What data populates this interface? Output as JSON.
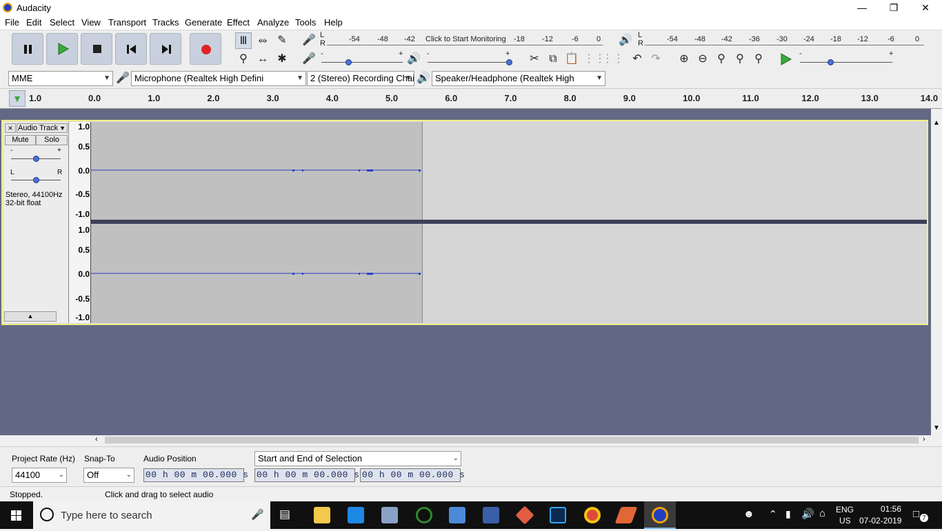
{
  "window": {
    "title": "Audacity",
    "min_icon": "minimize-icon",
    "max_icon": "restore-icon",
    "close_icon": "close-icon"
  },
  "menu": [
    "File",
    "Edit",
    "Select",
    "View",
    "Transport",
    "Tracks",
    "Generate",
    "Effect",
    "Analyze",
    "Tools",
    "Help"
  ],
  "transport": {
    "pause": "pause-icon",
    "play": "play-icon",
    "stop": "stop-icon",
    "skip_start": "skip-to-start-icon",
    "skip_end": "skip-to-end-icon",
    "record": "record-icon"
  },
  "meters": {
    "record_lr": [
      "L",
      "R"
    ],
    "record_scale": [
      "-54",
      "-48",
      "-42",
      "-18",
      "-12",
      "-6",
      "0"
    ],
    "monitor_text": "Click to Start Monitoring",
    "play_lr": [
      "L",
      "R"
    ],
    "play_scale": [
      "-54",
      "-48",
      "-42",
      "-36",
      "-30",
      "-24",
      "-18",
      "-12",
      "-6",
      "0"
    ],
    "rec_slider_minus": "-",
    "rec_slider_plus": "+",
    "play_slider_minus": "-",
    "play_slider_plus": "+",
    "speed_minus": "-",
    "speed_plus": "+",
    "rec_level": 0.33,
    "play_level": 1.0,
    "speed_level": 0.33
  },
  "device": {
    "host": "MME",
    "mic": "Microphone (Realtek High Defini",
    "channels": "2 (Stereo) Recording Chai",
    "speaker": "Speaker/Headphone (Realtek High"
  },
  "ruler": {
    "left_mark": "1.0",
    "ticks": [
      "0.0",
      "1.0",
      "2.0",
      "3.0",
      "4.0",
      "5.0",
      "6.0",
      "7.0",
      "8.0",
      "9.0",
      "10.0",
      "11.0",
      "12.0",
      "13.0",
      "14.0"
    ]
  },
  "track": {
    "close": "×",
    "name": "Audio Track",
    "mute": "Mute",
    "solo": "Solo",
    "gain_minus": "-",
    "gain_plus": "+",
    "pan_left": "L",
    "pan_right": "R",
    "info_line1": "Stereo, 44100Hz",
    "info_line2": "32-bit float",
    "gain_level": 0.5,
    "pan_level": 0.5,
    "v_labels": [
      "1.0",
      "0.5",
      "0.0",
      "-0.5",
      "-1.0"
    ]
  },
  "selection": {
    "rate_label": "Project Rate (Hz)",
    "rate_value": "44100",
    "snap_label": "Snap-To",
    "snap_value": "Off",
    "pos_label": "Audio Position",
    "pos_value": "00 h 00 m 00.000 s",
    "mode": "Start and End of Selection",
    "start_value": "00 h 00 m 00.000 s",
    "end_value": "00 h 00 m 00.000 s"
  },
  "status": {
    "state": "Stopped.",
    "hint": "Click and drag to select audio"
  },
  "taskbar": {
    "search_placeholder": "Type here to search",
    "lang1": "ENG",
    "lang2": "US",
    "time": "01:56",
    "date": "07-02-2019",
    "notif_count": "7"
  }
}
